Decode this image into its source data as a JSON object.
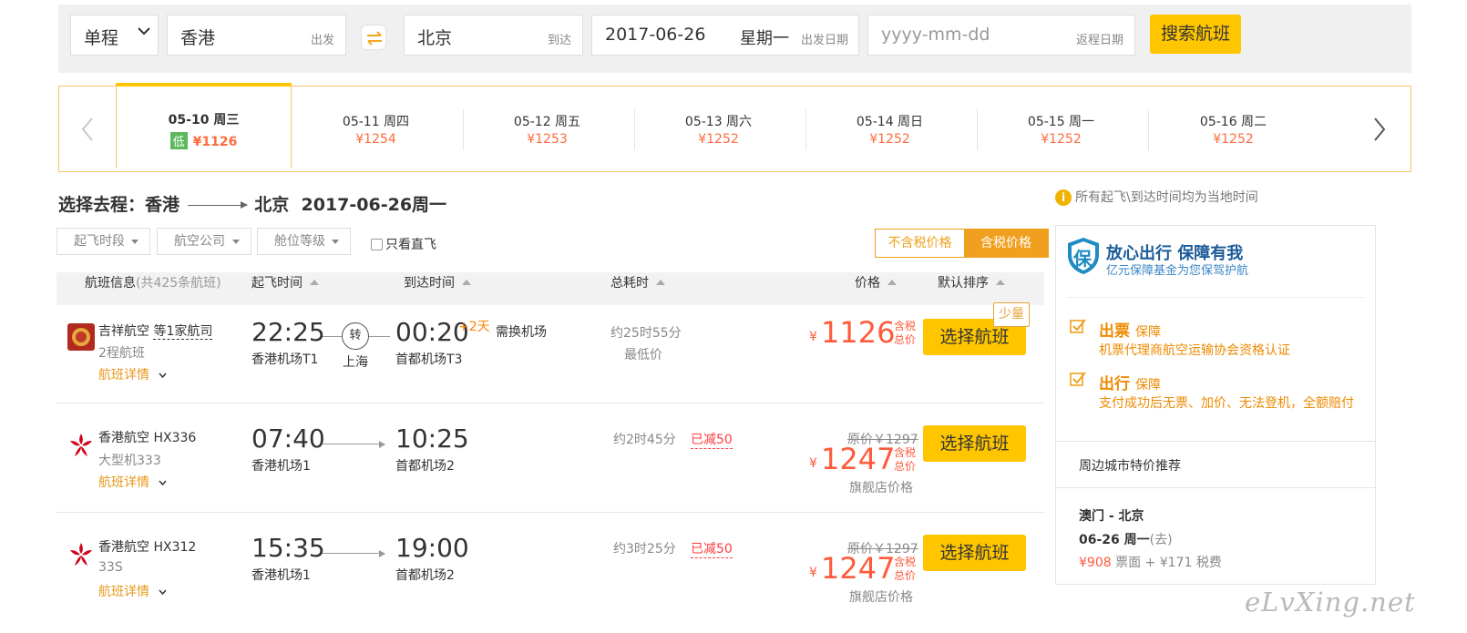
{
  "search": {
    "trip_type": "单程",
    "from_city": "香港",
    "from_hint": "出发",
    "to_city": "北京",
    "to_hint": "到达",
    "depart_date": "2017-06-26",
    "depart_weekday": "星期一",
    "depart_hint": "出发日期",
    "return_placeholder": "yyyy-mm-dd",
    "return_hint": "返程日期",
    "search_button": "搜索航班"
  },
  "date_strip": {
    "low_badge": "低",
    "dates": [
      {
        "label": "05-10 周三",
        "price": "¥1126",
        "active": true
      },
      {
        "label": "05-11 周四",
        "price": "¥1254"
      },
      {
        "label": "05-12 周五",
        "price": "¥1253"
      },
      {
        "label": "05-13 周六",
        "price": "¥1252"
      },
      {
        "label": "05-14 周日",
        "price": "¥1252"
      },
      {
        "label": "05-15 周一",
        "price": "¥1252"
      },
      {
        "label": "05-16 周二",
        "price": "¥1252"
      }
    ]
  },
  "route": {
    "prefix": "选择去程：香港",
    "to": "北京",
    "date": "2017-06-26周一"
  },
  "filters": {
    "time": "起飞时段",
    "airline": "航空公司",
    "cabin": "舱位等级",
    "direct": "只看直飞",
    "tax_excl": "不含税价格",
    "tax_incl": "含税价格"
  },
  "table_header": {
    "flight_info": "航班信息",
    "count": "(共425条航班)",
    "depart": "起飞时间",
    "arrive": "到达时间",
    "duration": "总耗时",
    "price": "价格",
    "sort": "默认排序"
  },
  "flights": [
    {
      "airline": "吉祥航空",
      "codeshare": "等1家航司",
      "aircraft": "2程航班",
      "detail": "航班详情",
      "dep_time": "22:25",
      "dep_airport": "香港机场T1",
      "transfer_mark": "转",
      "transfer_city": "上海",
      "arr_time": "00:20",
      "arr_plus": "+2天",
      "change_airport": "需换机场",
      "arr_airport": "首都机场T3",
      "duration": "约25时55分",
      "duration_note": "最低价",
      "currency": "¥",
      "price": "1126",
      "tax_label": "含税总价",
      "few_label": "少量",
      "book": "选择航班",
      "logo_color": "#c0392b"
    },
    {
      "airline": "香港航空 HX336",
      "aircraft": "大型机333",
      "detail": "航班详情",
      "dep_time": "07:40",
      "dep_airport": "香港机场1",
      "arr_time": "10:25",
      "arr_airport": "首都机场2",
      "duration": "约2时45分",
      "discount": "已减50",
      "original_price": "原价￥1297",
      "currency": "¥",
      "price": "1247",
      "tax_label": "含税总价",
      "store_note": "旗舰店价格",
      "book": "选择航班",
      "logo_color": "#d0021b"
    },
    {
      "airline": "香港航空 HX312",
      "aircraft": "33S",
      "detail": "航班详情",
      "dep_time": "15:35",
      "dep_airport": "香港机场1",
      "arr_time": "19:00",
      "arr_airport": "首都机场2",
      "duration": "约3时25分",
      "discount": "已减50",
      "original_price": "原价￥1297",
      "currency": "¥",
      "price": "1247",
      "tax_label": "含税总价",
      "store_note": "旗舰店价格",
      "book": "选择航班",
      "logo_color": "#d0021b"
    }
  ],
  "sidebar": {
    "note": "所有起飞\\到达时间均为当地时间",
    "guard_logo_char": "保",
    "guard_title": "放心出行 保障有我",
    "guard_sub": "亿元保障基金为您保驾护航",
    "items": [
      {
        "head": "出票",
        "tag": "保障",
        "desc": "机票代理商航空运输协会资格认证"
      },
      {
        "head": "出行",
        "tag": "保障",
        "desc": "支付成功后无票、加价、无法登机，全额赔付"
      }
    ],
    "nearby_title": "周边城市特价推荐",
    "nearby_route": "澳门 - 北京",
    "nearby_date": "06-26 周一",
    "nearby_go": "(去)",
    "nearby_fare": "¥908",
    "nearby_fare_label": "票面 +",
    "nearby_tax": "¥171 税费"
  },
  "watermark": "eLvXing.net",
  "colors": {
    "accent": "#ffc600",
    "price": "#ff5a3c",
    "orange": "#ee8a00",
    "brand_blue": "#1b5b98"
  }
}
